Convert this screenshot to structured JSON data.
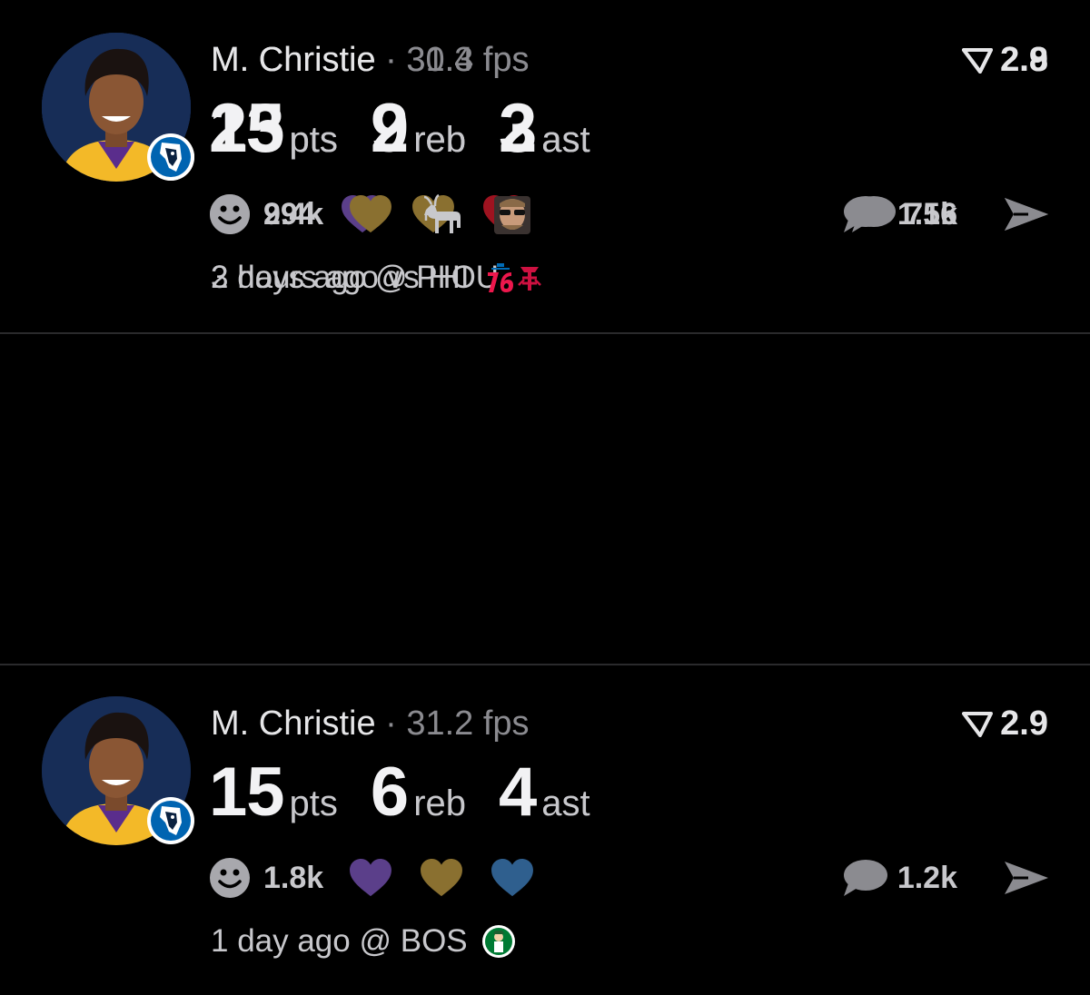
{
  "feed": [
    {
      "player": "M. Christie",
      "fps": "· 30.4 fps",
      "rating": "2.9",
      "stats": [
        {
          "value": "23",
          "label": "pts"
        },
        {
          "value": "2",
          "label": "reb"
        },
        {
          "value": "2",
          "label": "ast"
        }
      ],
      "reaction_count": "994",
      "reactions": [
        "purple-heart",
        "gold-heart",
        "red-heart"
      ],
      "comment_count": "716",
      "meta": "2 hours ago vs HOU",
      "opponent_logo": "rockets-logo"
    },
    {
      "player": "M. Christie",
      "fps": "· 31.2 fps",
      "rating": "2.9",
      "stats": [
        {
          "value": "15",
          "label": "pts"
        },
        {
          "value": "6",
          "label": "reb"
        },
        {
          "value": "4",
          "label": "ast"
        }
      ],
      "reaction_count": "1.8k",
      "reactions": [
        "purple-heart",
        "gold-heart",
        "blue-heart"
      ],
      "comment_count": "1.2k",
      "meta": "1 day ago @ BOS",
      "opponent_logo": "celtics-logo"
    },
    {
      "player": "M. Christie",
      "fps": "· 31.3 fps",
      "rating": "2.8",
      "stats": [
        {
          "value": "15",
          "label": "pts"
        },
        {
          "value": "9",
          "label": "reb"
        },
        {
          "value": "3",
          "label": "ast"
        }
      ],
      "reaction_count": "2.4k",
      "reactions": [
        "gold-heart",
        "goat",
        "sunglasses-face"
      ],
      "comment_count": "1.5k",
      "meta": "3 days ago @ PHI",
      "opponent_logo": "76ers-logo"
    }
  ],
  "colors": {
    "background": "#000000",
    "purple": "#5b3f8a",
    "gold": "#8a7030",
    "red": "#9e1320",
    "blue": "#2f5f8e",
    "muted": "#8b8b90"
  }
}
